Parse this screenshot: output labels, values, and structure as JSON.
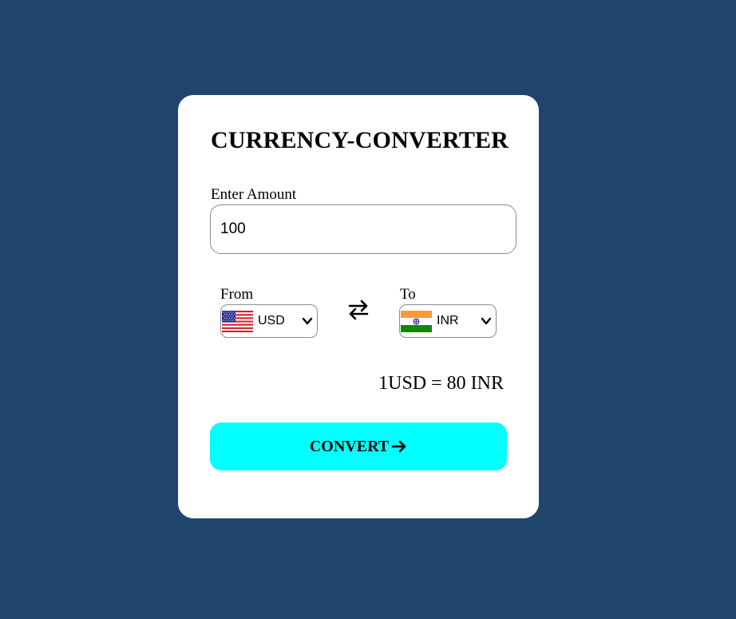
{
  "card": {
    "title": "CURRENCY-CONVERTER",
    "amount_label": "Enter Amount",
    "amount_value": "100",
    "from": {
      "label": "From",
      "currency": "USD",
      "flag_icon": "us-flag-icon"
    },
    "to": {
      "label": "To",
      "currency": "INR",
      "flag_icon": "india-flag-icon"
    },
    "swap_icon": "swap-arrows-icon",
    "rate_text": "1USD = 80 INR",
    "convert_label": "CONVERT",
    "convert_icon": "arrow-right-icon"
  },
  "colors": {
    "background": "#1f456d",
    "card": "#ffffff",
    "button": "#00ffff"
  }
}
